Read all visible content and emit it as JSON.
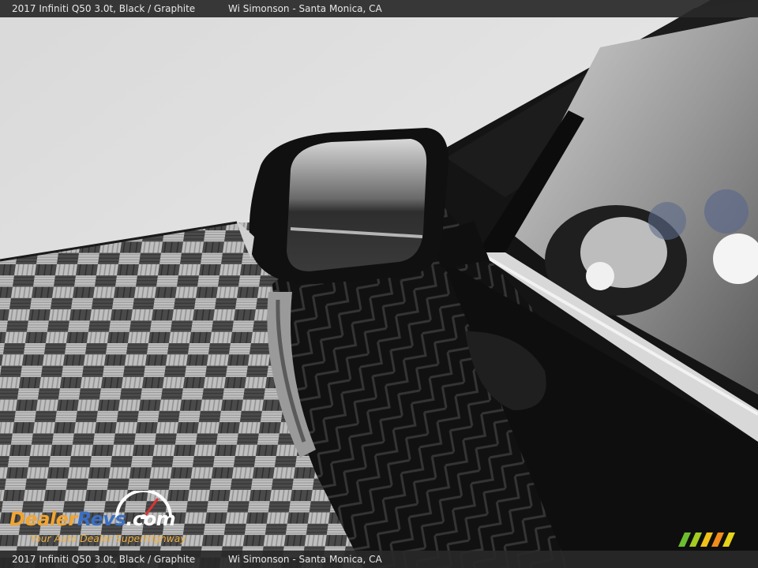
{
  "caption": {
    "vehicle": "2017 Infiniti Q50 3.0t,  Black / Graphite",
    "dealer": "Wi Simonson - Santa Monica, CA"
  },
  "watermark": {
    "brand_part1": "Dealer",
    "brand_part2": "Revs",
    "brand_part3": ".com",
    "tagline": "Your Auto Dealer SuperHighway",
    "colors": {
      "orange": "#f2a531",
      "blue": "#3a6fc4"
    }
  }
}
